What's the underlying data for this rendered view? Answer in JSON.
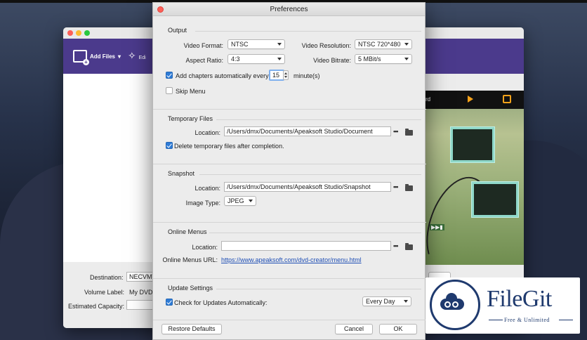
{
  "dialog": {
    "title": "Preferences",
    "restore_defaults": "Restore Defaults",
    "cancel": "Cancel",
    "ok": "OK"
  },
  "output": {
    "heading": "Output",
    "video_format_label": "Video Format:",
    "video_format_value": "NTSC",
    "video_resolution_label": "Video Resolution:",
    "video_resolution_value": "NTSC 720*480",
    "aspect_ratio_label": "Aspect Ratio:",
    "aspect_ratio_value": "4:3",
    "video_bitrate_label": "Video Bitrate:",
    "video_bitrate_value": "5 MBit/s",
    "add_chapters_label": "Add chapters automatically every",
    "add_chapters_checked": true,
    "add_chapters_value": "15",
    "minutes_label": "minute(s)",
    "skip_menu_label": "Skip Menu",
    "skip_menu_checked": false
  },
  "temporary_files": {
    "heading": "Temporary Files",
    "location_label": "Location:",
    "location_value": "/Users/dmx/Documents/Apeaksoft Studio/Document",
    "browse": "•••",
    "delete_label": "Delete temporary files after completion.",
    "delete_checked": true
  },
  "snapshot": {
    "heading": "Snapshot",
    "location_label": "Location:",
    "location_value": "/Users/dmx/Documents/Apeaksoft Studio/Snapshot",
    "browse": "•••",
    "image_type_label": "Image Type:",
    "image_type_value": "JPEG"
  },
  "online_menus": {
    "heading": "Online Menus",
    "location_label": "Location:",
    "location_value": "",
    "browse": "•••",
    "url_label": "Online Menus URL:",
    "url_value": "https://www.apeaksoft.com/dvd-creator/menu.html"
  },
  "update_settings": {
    "heading": "Update Settings",
    "check_label": "Check for Updates Automatically:",
    "check_checked": true,
    "frequency_value": "Every Day"
  },
  "background_app": {
    "add_files": "Add Files",
    "edit_partial": "Edi",
    "preview_partial": "rd",
    "destination_label": "Destination:",
    "destination_value": "NECVMW",
    "volume_label": "Volume Label:",
    "volume_value": "My DVD",
    "capacity_label": "Estimated Capacity:"
  },
  "watermark": {
    "title": "FileGit",
    "subtitle": "Free & Unlimited"
  }
}
